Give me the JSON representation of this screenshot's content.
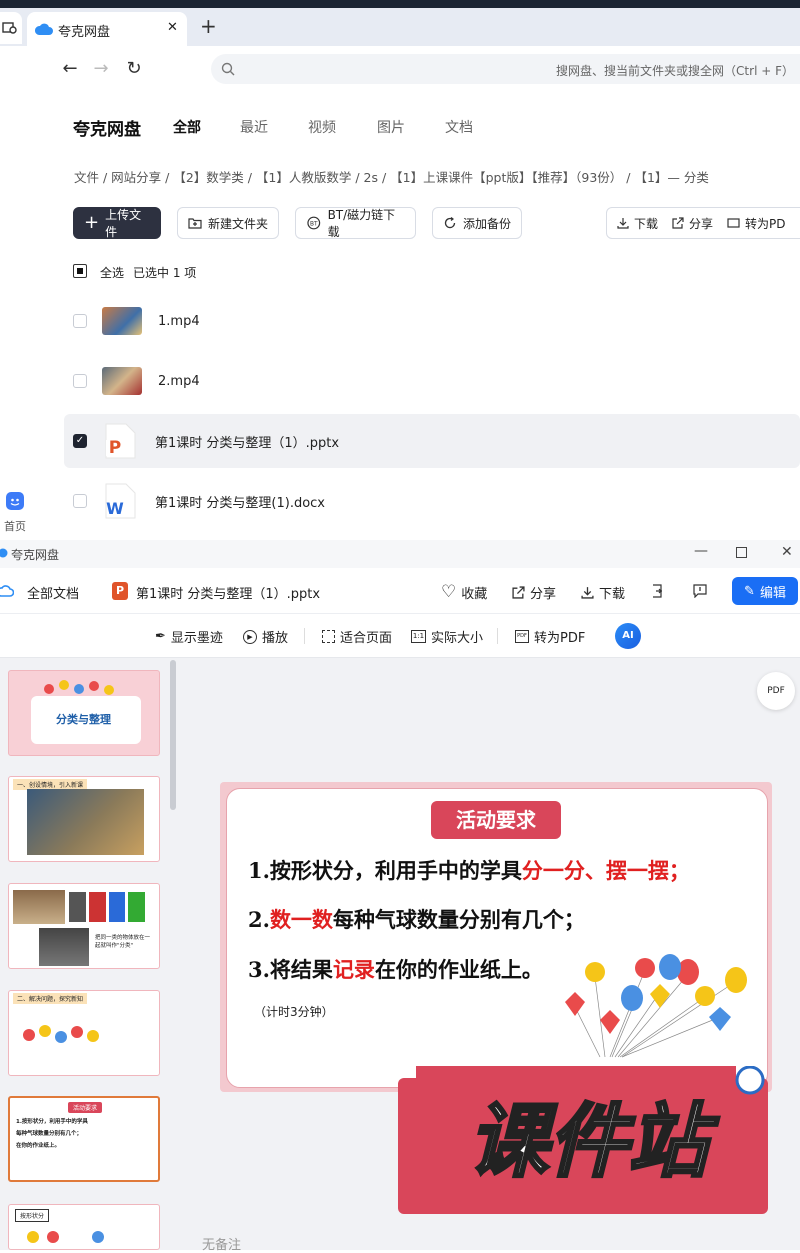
{
  "browser": {
    "tab_title": "夸克网盘",
    "tab_close": "✕",
    "new_tab": "+",
    "search_placeholder": "搜网盘、搜当前文件夹或搜全网（Ctrl + F）",
    "back": "←",
    "forward": "→",
    "reload": "↻"
  },
  "drive": {
    "brand": "夸克网盘",
    "tabs": [
      "全部",
      "最近",
      "视频",
      "图片",
      "文档"
    ],
    "active_tab": "全部",
    "breadcrumb": "文件 / 网站分享 / 【2】数学类 / 【1】人教版数学 / 2s / 【1】上课课件【ppt版】【推荐】（93份） / 【1】— 分类",
    "toolbar": {
      "upload": "上传文件",
      "new_folder": "新建文件夹",
      "bt": "BT/磁力链下载",
      "backup": "添加备份",
      "download": "下载",
      "share": "分享",
      "to_pdf": "转为PD"
    },
    "select_all": "全选",
    "selected_info": "已选中 1 项",
    "files": [
      {
        "name": "1.mp4",
        "checked": false
      },
      {
        "name": "2.mp4",
        "checked": false
      },
      {
        "name": "第1课时 分类与整理（1）.pptx",
        "checked": true
      },
      {
        "name": "第1课时    分类与整理(1).docx",
        "checked": false
      }
    ],
    "home_label": "首页"
  },
  "viewer": {
    "window_title": "夸克网盘",
    "all_docs": "全部文档",
    "doc_name": "第1课时 分类与整理（1）.pptx",
    "actions": {
      "favorite": "收藏",
      "share": "分享",
      "download": "下载",
      "edit": "编辑"
    },
    "tools": {
      "ink": "显示墨迹",
      "play": "播放",
      "fit": "适合页面",
      "actual": "实际大小",
      "topdf": "转为PDF"
    },
    "notes": "无备注",
    "slide": {
      "badge": "活动要求",
      "line1_a": "1.按形状分，利用手中的学具",
      "line1_b": "分一分、摆一摆；",
      "line2_a": "2.",
      "line2_b": "数一数",
      "line2_c": "每种气球数量分别有几个；",
      "line3_a": "3.将结果",
      "line3_b": "记录",
      "line3_c": "在你的作业纸上。",
      "timer": "（计时3分钟）"
    },
    "thumbs": [
      {
        "title": "分类与整理"
      },
      {
        "title": "一、创设情境，引入新课"
      },
      {
        "title": "把同一类的物体放在一起就叫作\"分类\""
      },
      {
        "title": "二、解决问题，探究新知"
      },
      {
        "title": "活动要求"
      },
      {
        "title": "按形状分"
      }
    ],
    "watermark": "课件站"
  },
  "colors": {
    "accent": "#1a73e8",
    "edit": "#1a6ef5",
    "badge": "#d9465a",
    "red": "#e02020",
    "upload_btn": "#2d3140"
  }
}
